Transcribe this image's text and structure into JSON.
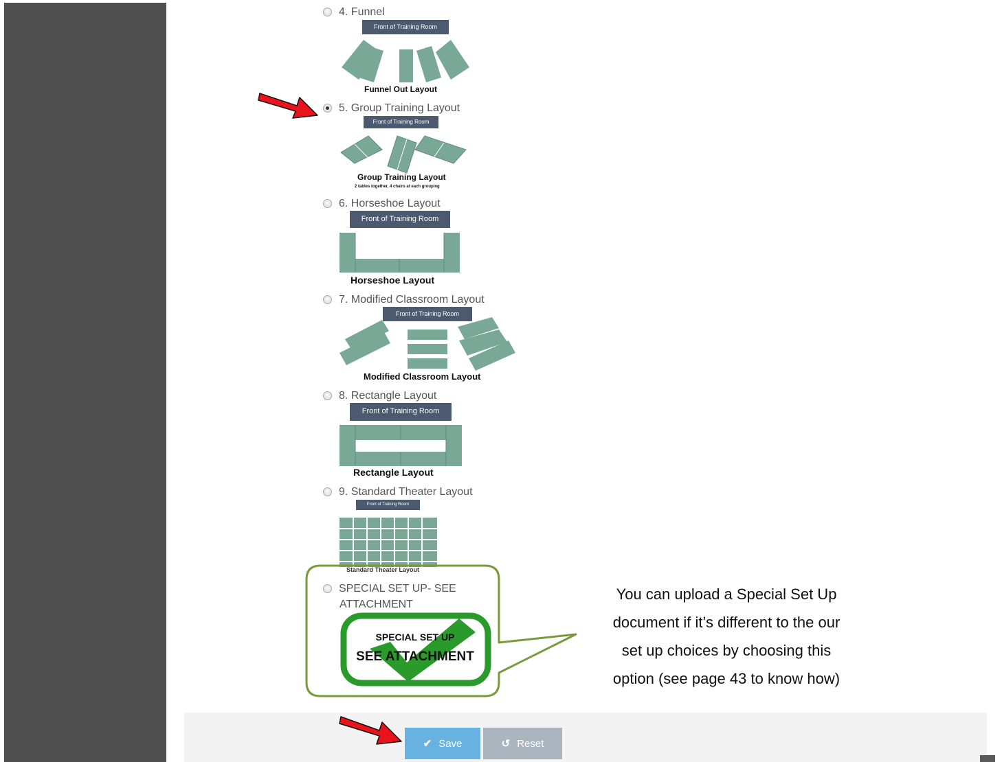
{
  "options": [
    {
      "label": "4. Funnel",
      "selected": false,
      "front_label": "Front of Training Room",
      "caption": "Funnel Out Layout"
    },
    {
      "label": "5. Group Training Layout",
      "selected": true,
      "front_label": "Front of Training Room",
      "caption": "Group Training Layout",
      "subcaption": "2 tables together, 4 chairs at each grouping"
    },
    {
      "label": "6. Horseshoe Layout",
      "selected": false,
      "front_label": "Front of Training Room",
      "caption": "Horseshoe Layout"
    },
    {
      "label": "7. Modified Classroom Layout",
      "selected": false,
      "front_label": "Front of Training Room",
      "caption": "Modified Classroom Layout"
    },
    {
      "label": "8. Rectangle Layout",
      "selected": false,
      "front_label": "Front of Training Room",
      "caption": "Rectangle Layout"
    },
    {
      "label": "9. Standard Theater Layout",
      "selected": false,
      "front_label": "Front of Training Room",
      "caption": "Standard Theater Layout"
    },
    {
      "label_line1": "SPECIAL SET UP- SEE",
      "label_line2": "ATTACHMENT",
      "selected": false,
      "image_text_1": "SPECIAL SET UP",
      "image_text_2": "SEE ATTACHMENT"
    }
  ],
  "callout": {
    "line1": "You can upload a Special Set Up",
    "line2": "document if it’s different to the our",
    "line3": "set up choices by choosing this",
    "line4": "option (see page 43 to know how)"
  },
  "footer": {
    "save_label": "Save",
    "reset_label": "Reset",
    "save_icon": "check-icon",
    "reset_icon": "undo-icon"
  },
  "colors": {
    "table": "#7aa897",
    "front_bar": "#4b5a6e",
    "callout_border": "#7a9a3c",
    "arrow": "#e8131b",
    "save_button": "#67b2e0",
    "reset_button": "#aab5bf",
    "sidebar": "#4f4f4f",
    "special_green": "#2a9a2a"
  }
}
